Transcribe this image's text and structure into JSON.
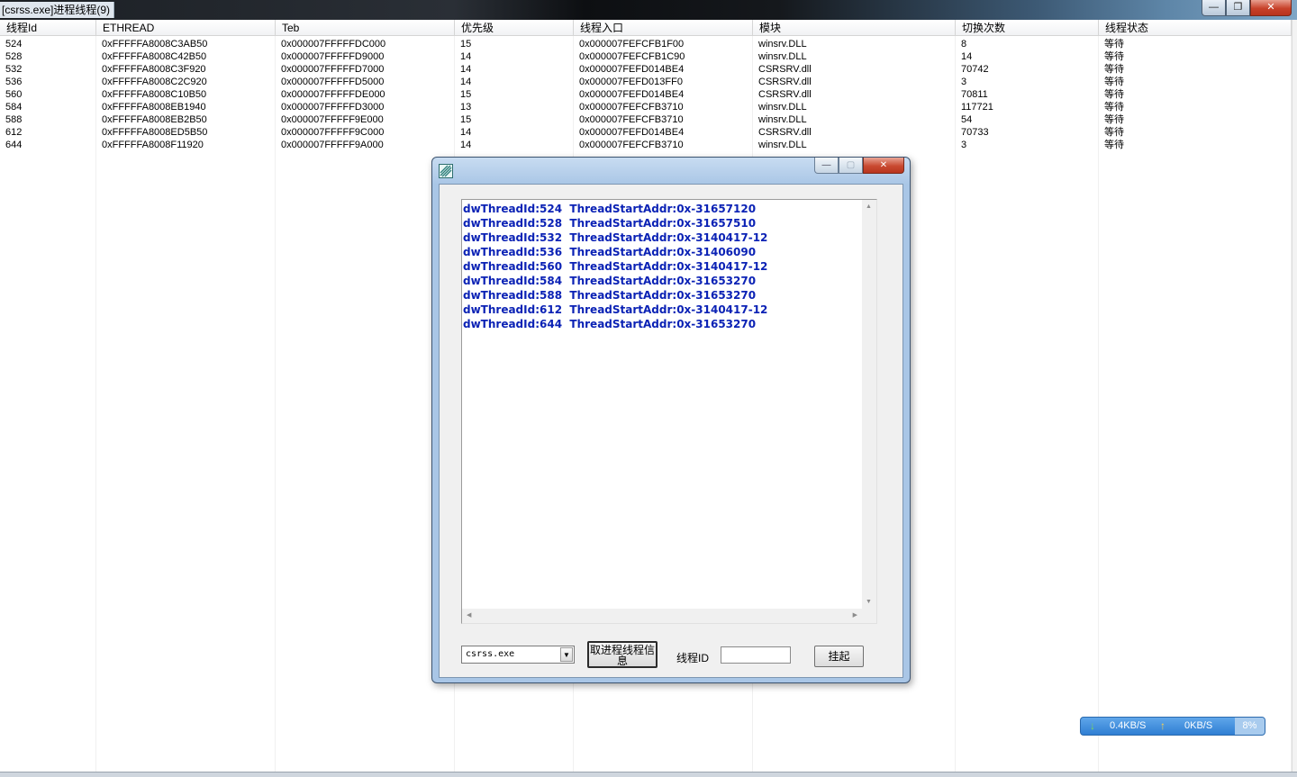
{
  "window": {
    "title": "[csrss.exe]进程线程(9)",
    "min_glyph": "—",
    "max_glyph": "❐",
    "close_glyph": "✕"
  },
  "columns": [
    "线程Id",
    "ETHREAD",
    "Teb",
    "优先级",
    "线程入口",
    "模块",
    "切换次数",
    "线程状态"
  ],
  "rows": [
    [
      "524",
      "0xFFFFFA8008C3AB50",
      "0x000007FFFFFDC000",
      "15",
      "0x000007FEFCFB1F00",
      "winsrv.DLL",
      "8",
      "等待"
    ],
    [
      "528",
      "0xFFFFFA8008C42B50",
      "0x000007FFFFFD9000",
      "14",
      "0x000007FEFCFB1C90",
      "winsrv.DLL",
      "14",
      "等待"
    ],
    [
      "532",
      "0xFFFFFA8008C3F920",
      "0x000007FFFFFD7000",
      "14",
      "0x000007FEFD014BE4",
      "CSRSRV.dll",
      "70742",
      "等待"
    ],
    [
      "536",
      "0xFFFFFA8008C2C920",
      "0x000007FFFFFD5000",
      "14",
      "0x000007FEFD013FF0",
      "CSRSRV.dll",
      "3",
      "等待"
    ],
    [
      "560",
      "0xFFFFFA8008C10B50",
      "0x000007FFFFFDE000",
      "15",
      "0x000007FEFD014BE4",
      "CSRSRV.dll",
      "70811",
      "等待"
    ],
    [
      "584",
      "0xFFFFFA8008EB1940",
      "0x000007FFFFFD3000",
      "13",
      "0x000007FEFCFB3710",
      "winsrv.DLL",
      "117721",
      "等待"
    ],
    [
      "588",
      "0xFFFFFA8008EB2B50",
      "0x000007FFFFF9E000",
      "15",
      "0x000007FEFCFB3710",
      "winsrv.DLL",
      "54",
      "等待"
    ],
    [
      "612",
      "0xFFFFFA8008ED5B50",
      "0x000007FFFFF9C000",
      "14",
      "0x000007FEFD014BE4",
      "CSRSRV.dll",
      "70733",
      "等待"
    ],
    [
      "644",
      "0xFFFFFA8008F11920",
      "0x000007FFFFF9A000",
      "14",
      "0x000007FEFCFB3710",
      "winsrv.DLL",
      "3",
      "等待"
    ]
  ],
  "dialog": {
    "min_glyph": "—",
    "max_glyph": "▢",
    "close_glyph": "✕",
    "output_lines": [
      "dwThreadId:524  ThreadStartAddr:0x-31657120",
      "dwThreadId:528  ThreadStartAddr:0x-31657510",
      "dwThreadId:532  ThreadStartAddr:0x-3140417-12",
      "dwThreadId:536  ThreadStartAddr:0x-31406090",
      "dwThreadId:560  ThreadStartAddr:0x-3140417-12",
      "dwThreadId:584  ThreadStartAddr:0x-31653270",
      "dwThreadId:588  ThreadStartAddr:0x-31653270",
      "dwThreadId:612  ThreadStartAddr:0x-3140417-12",
      "dwThreadId:644  ThreadStartAddr:0x-31653270"
    ],
    "process_combo_value": "csrss.exe",
    "get_info_button_line1": "取进程线程信",
    "get_info_button_line2": "息",
    "thread_id_label": "线程ID",
    "thread_id_value": "",
    "suspend_button": "挂起"
  },
  "netwidget": {
    "down_glyph": "↓",
    "down_speed": "0.4KB/S",
    "up_glyph": "↑",
    "up_speed": "0KB/S",
    "cpu_percent": "8%"
  },
  "colors": {
    "output_text": "#0b22b5",
    "close_button": "#c7412a",
    "net_widget": "#2f7fd3"
  }
}
